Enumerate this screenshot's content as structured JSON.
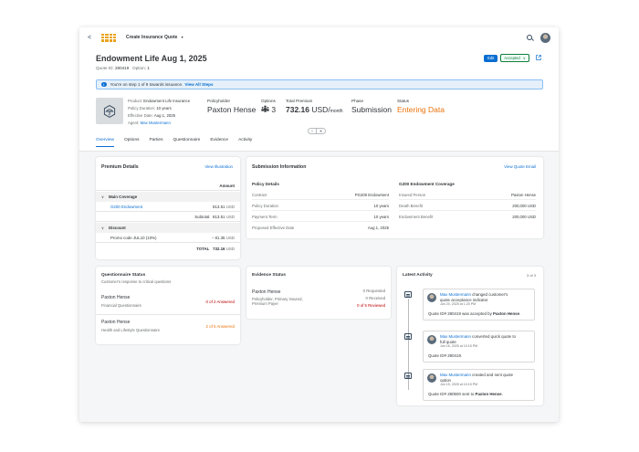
{
  "shell": {
    "back": "<",
    "app_title": "Create Insurance Quote",
    "app_title_caret": "▼"
  },
  "header": {
    "title": "Endowment Life Aug 1, 2025",
    "quote_id_label": "Quote ID:",
    "quote_id": "280419",
    "option_label": "Option:",
    "option": "1",
    "edit_label": "Edit",
    "status_label": "Accepted",
    "status_caret": "∨",
    "message": "You're on step 1 of 9 towards issuance.",
    "message_link": "View All Steps",
    "product_label": "Product:",
    "product": "Endowment Life Insurance",
    "policy_duration_label": "Policy Duration:",
    "policy_duration": "10 years",
    "effective_date_label": "Effective Date:",
    "effective_date": "Aug 1, 2025",
    "agent_label": "Agent:",
    "agent": "Max Mustermann",
    "policyholder_label": "Policyholder",
    "policyholder": "Paxton Hense",
    "options_label": "Options",
    "options_value": "3",
    "total_premium_label": "Total Premium",
    "total_premium": "732.16",
    "total_premium_unit": "USD/",
    "total_premium_period": "month",
    "phase_label": "Phase",
    "phase": "Submission",
    "status_field_label": "Status",
    "status_value": "Entering Data",
    "accent": "#0a6ed1",
    "status_color": "#e9730c"
  },
  "tabs": [
    "Overview",
    "Options",
    "Parties",
    "Questionnaire",
    "Evidence",
    "Activity"
  ],
  "premium": {
    "title": "Premium Details",
    "link": "View Illustration",
    "amount_header": "Amount",
    "main_coverage": "Main Coverage",
    "g200_label": "G200 Endowment",
    "g200_value": "813.51",
    "usd": "USD",
    "subtotal_label": "Subtotal",
    "subtotal_value": "813.51",
    "discount": "Discount",
    "promo_label": "Promo code JUL10 (10%)",
    "promo_value": "− 81.35",
    "total_label": "TOTAL",
    "total_value": "732.16"
  },
  "submission": {
    "title": "Submission Information",
    "link": "View Quote Email",
    "policy_details": "Policy Details",
    "contract_label": "Contract",
    "contract": "PG200 Endowment",
    "duration_label": "Policy Duration",
    "duration": "10 years",
    "payment_label": "Payment Term",
    "payment": "10 years",
    "proposed_label": "Proposed Effective Date",
    "proposed": "Aug 1, 2025",
    "coverage_title": "G200 Endowment Coverage",
    "insured_label": "Insured Person",
    "insured": "Paxton Hense",
    "death_label": "Death Benefit",
    "death": "200,000 USD",
    "endow_label": "Endowment Benefit",
    "endow": "200,000 USD"
  },
  "questionnaire": {
    "title": "Questionnaire Status",
    "subtitle": "Customer's response to critical questions",
    "items": [
      {
        "name": "Paxton Hense",
        "desc": "Financial Questionnaire",
        "status": "0 of 2 Answered"
      },
      {
        "name": "Paxton Hense",
        "desc": "Health and Lifestyle Questionnaire",
        "status": "2 of 5 Answered"
      }
    ]
  },
  "evidence": {
    "title": "Evidence Status",
    "name": "Paxton Hense",
    "desc_line1": "Policyholder, Primary Insured,",
    "desc_line2": "Premium Payer",
    "requested": "0 Requested",
    "received": "0 Received",
    "reviewed": "0 of 5 Reviewed"
  },
  "activity": {
    "title": "Latest Activity",
    "count": "3 of 3",
    "items": [
      {
        "user": "Max Mustermann",
        "action": "changed customer's",
        "action2": "quote acceptance indicator",
        "time": "Jun 20, 2025 at 1:20 PM",
        "body": "Quote ID# 280419 was accepted by ",
        "body_bold": "Paxton Hense",
        "body_end": "."
      },
      {
        "user": "Max Mustermann",
        "action": "converted quick quote to",
        "action2": "full quote",
        "time": "Jun 16, 2025 at 10:15 PM",
        "body": "Quote ID# 280419.",
        "body_bold": "",
        "body_end": ""
      },
      {
        "user": "Max Mustermann",
        "action": "created and sent quote",
        "action2": "option",
        "time": "Jun 15, 2025 at 10:15 PM",
        "body": "Quote ID# 280500 sent to ",
        "body_bold": "Paxton Hense",
        "body_end": "."
      }
    ]
  }
}
